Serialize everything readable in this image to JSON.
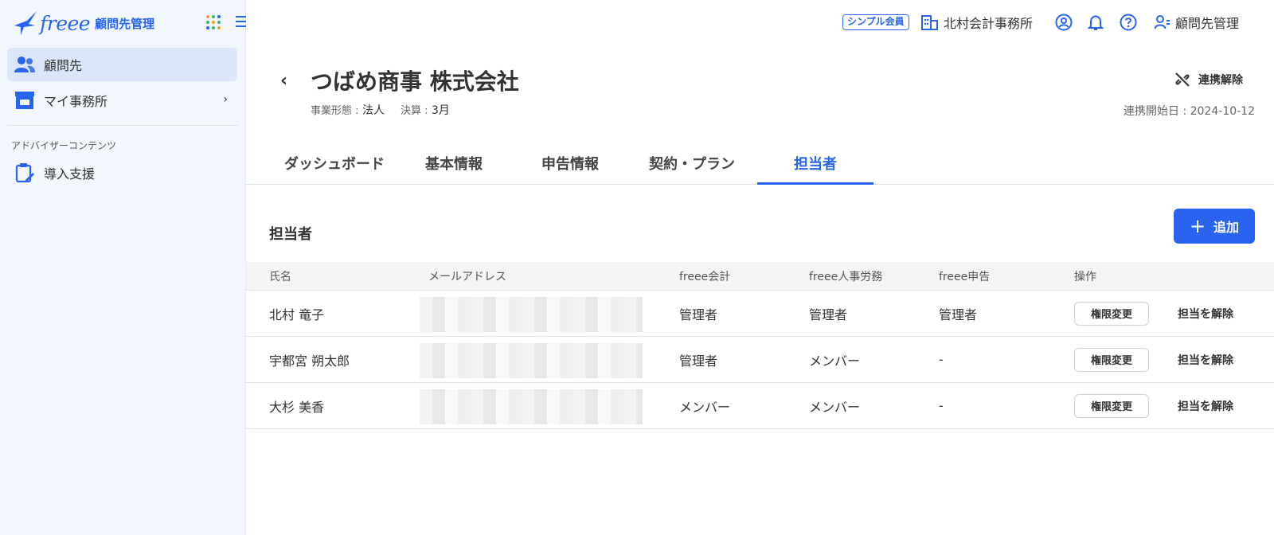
{
  "sidebar": {
    "logo_text": "freee",
    "logo_sub": "顧問先管理",
    "items": [
      {
        "label": "顧問先",
        "icon": "users-icon",
        "active": true
      },
      {
        "label": "マイ事務所",
        "icon": "store-icon",
        "active": false
      }
    ],
    "section_label": "アドバイザーコンテンツ",
    "section_items": [
      {
        "label": "導入支援",
        "icon": "clipboard-edit-icon"
      }
    ]
  },
  "header": {
    "badge": "シンプル会員",
    "office_name": "北村会計事務所",
    "client_mgmt": "顧問先管理"
  },
  "company": {
    "name": "つばめ商事 株式会社",
    "business_type_label": "事業形態 :",
    "business_type": "法人",
    "fiscal_label": "決算 :",
    "fiscal_month": "3月",
    "unlink_label": "連携解除",
    "link_start": "連携開始日 : 2024-10-12"
  },
  "tabs": [
    {
      "label": "ダッシュボード"
    },
    {
      "label": "基本情報"
    },
    {
      "label": "申告情報"
    },
    {
      "label": "契約・プラン"
    },
    {
      "label": "担当者"
    }
  ],
  "section": {
    "title": "担当者",
    "add_label": "追加"
  },
  "table": {
    "headers": [
      "氏名",
      "メールアドレス",
      "freee会計",
      "freee人事労務",
      "freee申告",
      "操作"
    ],
    "rows": [
      {
        "name": "北村 竜子",
        "accounting": "管理者",
        "hr": "管理者",
        "tax": "管理者"
      },
      {
        "name": "宇都宮 朔太郎",
        "accounting": "管理者",
        "hr": "メンバー",
        "tax": "-"
      },
      {
        "name": "大杉 美香",
        "accounting": "メンバー",
        "hr": "メンバー",
        "tax": "-"
      }
    ],
    "perm_label": "権限変更",
    "remove_label": "担当を解除"
  },
  "colors": {
    "accent": "#2864f0",
    "sidebar_bg": "#f2f6fd",
    "active_bg": "#dbe6fb"
  }
}
